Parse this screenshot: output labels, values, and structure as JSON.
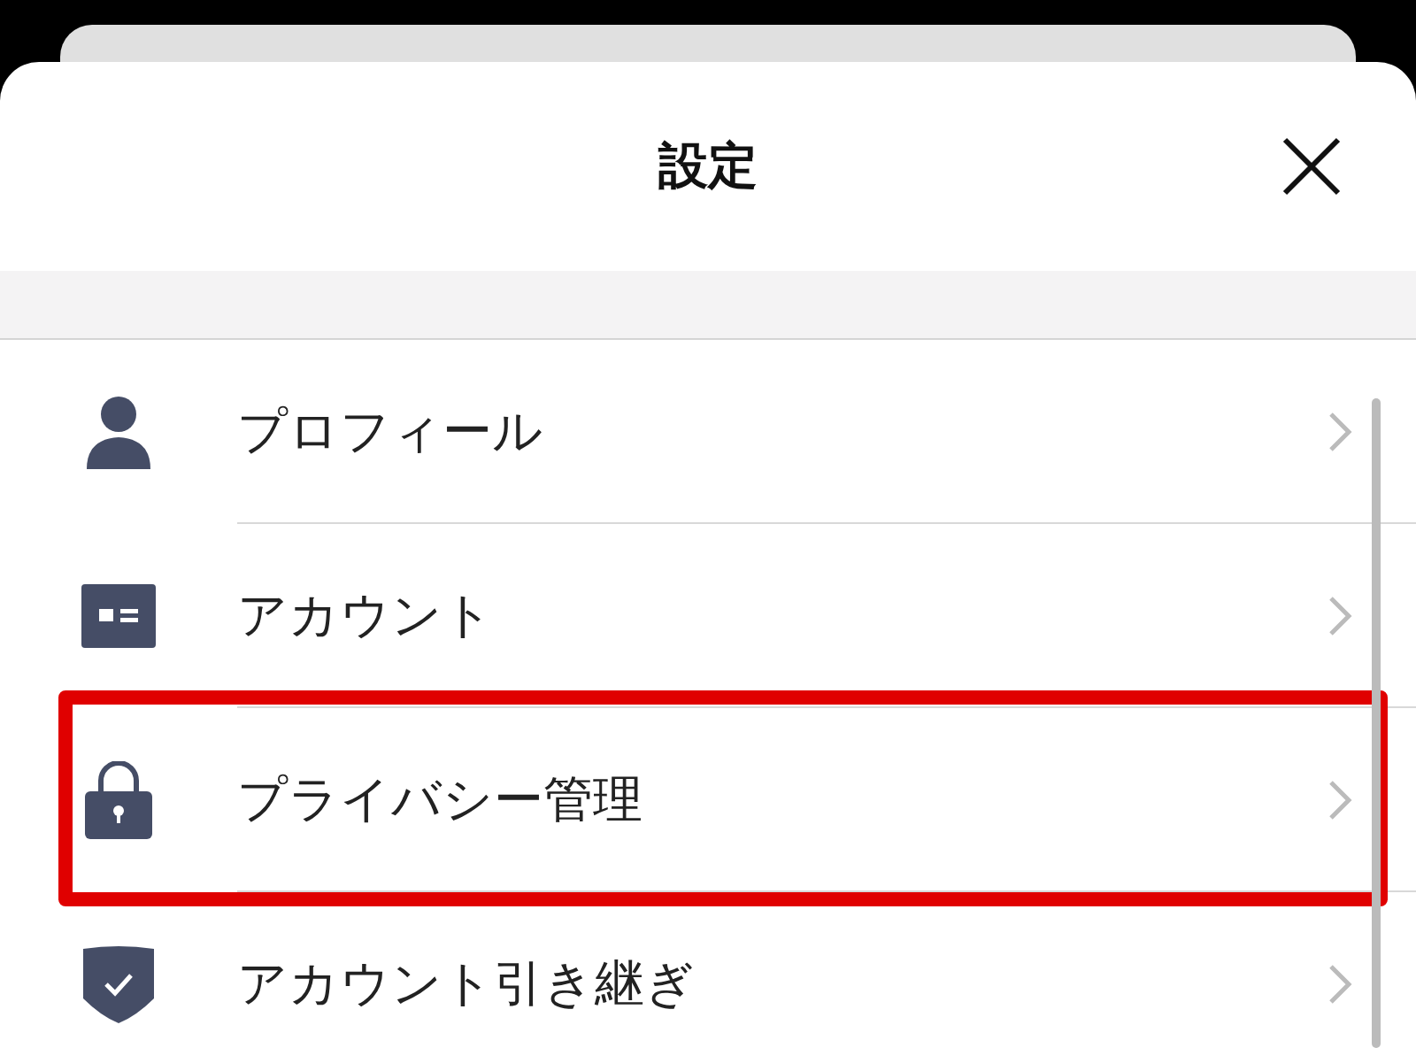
{
  "header": {
    "title": "設定"
  },
  "items": [
    {
      "label": "プロフィール",
      "highlighted": false
    },
    {
      "label": "アカウント",
      "highlighted": false
    },
    {
      "label": "プライバシー管理",
      "highlighted": true
    },
    {
      "label": "アカウント引き継ぎ",
      "highlighted": false
    }
  ]
}
